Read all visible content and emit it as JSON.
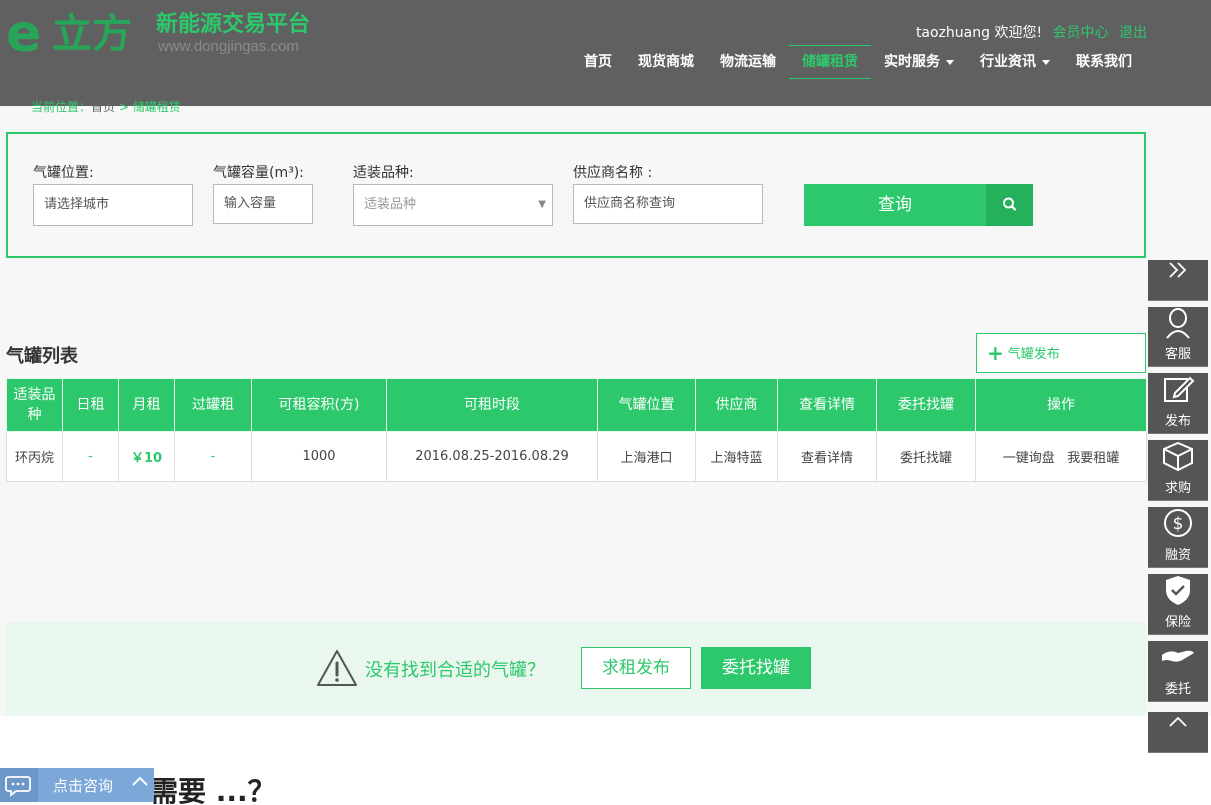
{
  "header": {
    "logo_e": "e",
    "logo_name": "立方",
    "logo_slogan": "新能源交易平台",
    "logo_url": "www.dongjingas.com",
    "username": "taozhuang",
    "welcome": "欢迎您!",
    "member_center": "会员中心",
    "logout": "退出",
    "nav": [
      {
        "label": "首页"
      },
      {
        "label": "现货商城"
      },
      {
        "label": "物流运输"
      },
      {
        "label": "储罐租赁"
      },
      {
        "label": "实时服务"
      },
      {
        "label": "行业资讯"
      },
      {
        "label": "联系我们"
      }
    ]
  },
  "breadcrumb": {
    "prefix": "当前位置：",
    "home": "首页",
    "sep": ">",
    "current": "储罐租赁"
  },
  "search": {
    "location_label": "气罐位置:",
    "location_placeholder": "请选择城市",
    "capacity_label": "气罐容量(m³):",
    "capacity_placeholder": "输入容量",
    "variety_label": "适装品种:",
    "variety_placeholder": "适装品种",
    "supplier_label": "供应商名称 :",
    "supplier_placeholder": "供应商名称查询",
    "submit_label": "查询"
  },
  "list": {
    "title": "气罐列表",
    "publish_label": "气罐发布",
    "columns": [
      "适装品种",
      "日租",
      "月租",
      "过罐租",
      "可租容积(方)",
      "可租时段",
      "气罐位置",
      "供应商",
      "查看详情",
      "委托找罐",
      "操作"
    ],
    "rows": [
      {
        "variety": "环丙烷",
        "daily": "-",
        "monthly": "￥10",
        "transfer": "-",
        "volume": "1000",
        "period": "2016.08.25-2016.08.29",
        "location": "上海港口",
        "supplier": "上海特蓝",
        "detail": "查看详情",
        "entrust": "委托找罐",
        "action1": "一键询盘",
        "action2": "我要租罐"
      }
    ]
  },
  "notice": {
    "text": "没有找到合适的气罐？",
    "btn1": "求租发布",
    "btn2": "委托找罐"
  },
  "bottom": {
    "heading": "需要 ...？"
  },
  "consult": {
    "label": "点击咨询"
  },
  "sidebar": {
    "items": [
      {
        "label": "客服"
      },
      {
        "label": "发布"
      },
      {
        "label": "求购"
      },
      {
        "label": "融资"
      },
      {
        "label": "保险"
      },
      {
        "label": "委托"
      }
    ]
  },
  "colors": {
    "accent": "#2dc86b",
    "header_bg": "#606060",
    "sidebar_bg": "#555555"
  }
}
